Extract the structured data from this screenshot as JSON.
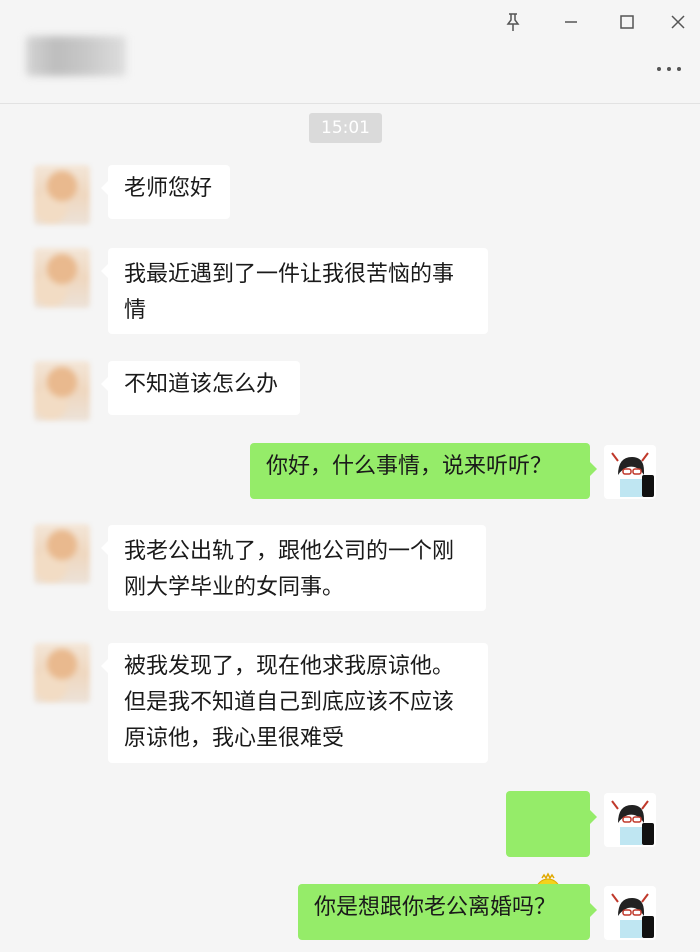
{
  "window": {
    "contact_name": "",
    "more_icon": "more-dots-icon",
    "controls": [
      "pin-icon",
      "minimize-icon",
      "maximize-icon",
      "close-icon"
    ]
  },
  "chat": {
    "timestamp": "15:01",
    "messages": [
      {
        "sender": "other",
        "text": "老师您好"
      },
      {
        "sender": "other",
        "text": "我最近遇到了一件让我很苦恼的事\n情"
      },
      {
        "sender": "other",
        "text": "不知道该怎么办"
      },
      {
        "sender": "me",
        "text": "你好，什么事情，说来听听？"
      },
      {
        "sender": "other",
        "text": "我老公出轨了，跟他公司的一个刚\n刚大学毕业的女同事。"
      },
      {
        "sender": "other",
        "text": "被我发现了，现在他求我原谅他。\n但是我不知道自己到底应该不应该\n原谅他，我心里很难受"
      },
      {
        "sender": "me",
        "sticker": "chick-sticker"
      },
      {
        "sender": "me",
        "text": "你是想跟你老公离婚吗？"
      }
    ]
  },
  "colors": {
    "background": "#f5f5f5",
    "self_bubble": "#95ec69",
    "other_bubble": "#ffffff",
    "time_chip": "#dadada"
  }
}
